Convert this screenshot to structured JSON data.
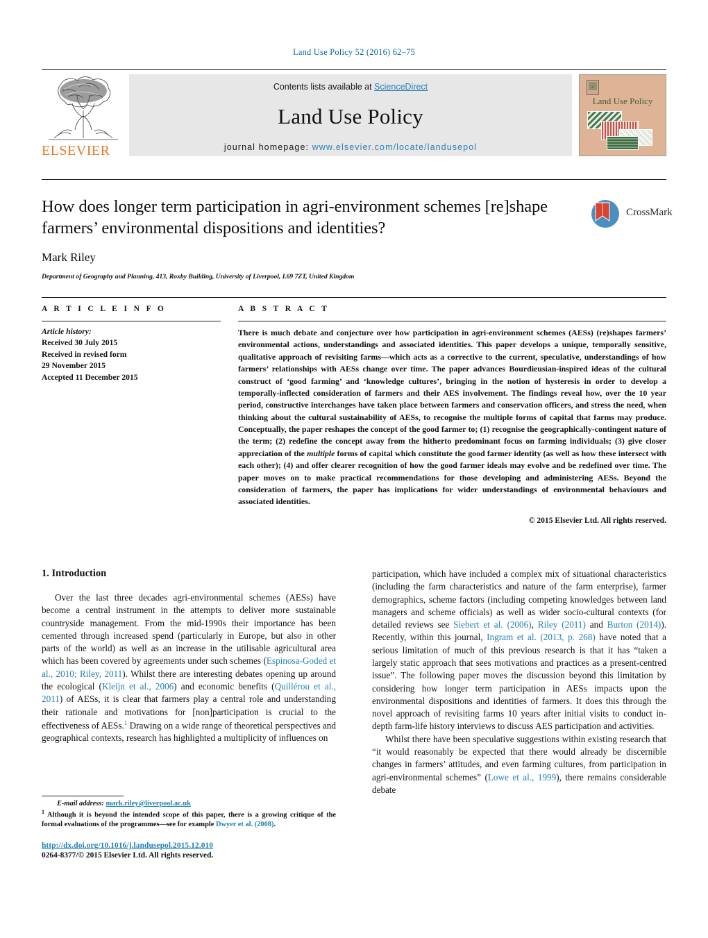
{
  "running_head": "Land Use Policy 52 (2016) 62–75",
  "masthead": {
    "contents_prefix": "Contents lists available at ",
    "sciencedirect": "ScienceDirect",
    "journal_title": "Land Use Policy",
    "homepage_prefix": "journal homepage: ",
    "homepage_url": "www.elsevier.com/locate/landusepol",
    "publisher_wordmark": "ELSEVIER",
    "cover_title": "Land Use Policy",
    "accent_link": "#2a7fb8",
    "cover_bg": "#dfb395"
  },
  "article": {
    "title": "How does longer term participation in agri-environment schemes [re]shape farmers’ environmental dispositions and identities?",
    "author": "Mark Riley",
    "affiliation": "Department of Geography and Planning, 413, Roxby Building, University of Liverpool, L69 7ZT, United Kingdom",
    "crossmark_label": "CrossMark"
  },
  "info": {
    "heading": "A R T I C L E   I N F O",
    "history_label": "Article history:",
    "history": [
      "Received 30 July 2015",
      "Received in revised form",
      "29 November 2015",
      "Accepted 11 December 2015"
    ]
  },
  "abstract": {
    "heading": "A B S T R A C T",
    "part1": "There is much debate and conjecture over how participation in agri-environment schemes (AESs) (re)shapes farmers’ environmental actions, understandings and associated identities. This paper develops a unique, temporally sensitive, qualitative approach of revisiting farms—which acts as a corrective to the current, speculative, understandings of how farmers’ relationships with AESs change over time. The paper advances Bourdieusian-inspired ideas of the cultural construct of ‘good farming’ and ‘knowledge cultures’, bringing in the notion of hysteresis in order to develop a temporally-inflected consideration of farmers and their AES involvement. The findings reveal how, over the 10 year period, constructive interchanges have taken place between farmers and conservation officers, and stress the need, when thinking about the cultural sustainability of AESs, to recognise the multiple forms of capital that farms may produce. Conceptually, the paper reshapes the concept of the good farmer to; (1) recognise the geographically-contingent nature of the term; (2) redefine the concept away from the hitherto predominant focus on farming individuals; (3) give closer appreciation of the ",
    "italic_word": "multiple",
    "part2": " forms of capital which constitute the good farmer identity (as well as how these intersect with each other); (4) and offer clearer recognition of how the good farmer ideals may evolve and be redefined over time. The paper moves on to make practical recommendations for those developing and administering AESs. Beyond the consideration of farmers, the paper has implications for wider understandings of environmental behaviours and associated identities.",
    "copyright": "© 2015 Elsevier Ltd. All rights reserved."
  },
  "body": {
    "section_heading": "1. Introduction",
    "left_p1_a": "Over the last three decades agri-environmental schemes (AESs) have become a central instrument in the attempts to deliver more sustainable countryside management. From the mid-1990s their importance has been cemented through increased spend (particularly in Europe, but also in other parts of the world) as well as an increase in the utilisable agricultural area which has been covered by agreements under such schemes (",
    "ref_espinosa": "Espinosa-Goded et al., 2010; Riley, 2011",
    "left_p1_b": "). Whilst there are interesting debates opening up around the ecological (",
    "ref_kleijn": "Kleijn et al., 2006",
    "left_p1_c": ") and economic benefits (",
    "ref_quillerou": "Quillérou et al., 2011",
    "left_p1_d": ") of AESs, it is clear that farmers play a central role and understanding their rationale and motivations for [non]participation is crucial to the effectiveness of AESs.",
    "footnote_marker": "1",
    "left_p1_e": " Drawing on a wide range of theoretical perspectives and geographical contexts, research has highlighted a multiplicity of influences on",
    "right_p1_a": "participation, which have included a complex mix of situational characteristics (including the farm characteristics and nature of the farm enterprise), farmer demographics, scheme factors (including competing knowledges between land managers and scheme officials) as well as wider socio-cultural contexts (for detailed reviews see ",
    "ref_siebert": "Siebert et al. (2006)",
    "right_p1_b": ", ",
    "ref_riley": "Riley (2011)",
    "right_p1_c": " and ",
    "ref_burton": "Burton (2014)",
    "right_p1_d": "). Recently, within this journal, ",
    "ref_ingram": "Ingram et al. (2013, p. 268)",
    "right_p1_e": " have noted that a serious limitation of much of this previous research is that it has “taken a largely static approach that sees motivations and practices as a present-centred issue”. The following paper moves the discussion beyond this limitation by considering how longer term participation in AESs impacts upon the environmental dispositions and identities of farmers. It does this through the novel approach of revisiting farms 10 years after initial visits to conduct in-depth farm-life history interviews to discuss AES participation and activities.",
    "right_p2_a": "Whilst there have been speculative suggestions within existing research that “it would reasonably be expected that there would already be discernible changes in farmers’ attitudes, and even farming cultures, from participation in agri-environmental schemes” (",
    "ref_lowe": "Lowe et al., 1999",
    "right_p2_b": "), there remains considerable debate"
  },
  "footer": {
    "email_label": "E-mail address:",
    "email": "mark.riley@liverpool.ac.uk",
    "footnote_marker": "1",
    "footnote_a": "Although it is beyond the intended scope of this paper, there is a growing critique of the formal evaluations of the programmes—see for example ",
    "footnote_ref": "Dwyer et al. (2008)",
    "footnote_b": ".",
    "doi": "http://dx.doi.org/10.1016/j.landusepol.2015.12.010",
    "issn": "0264-8377/© 2015 Elsevier Ltd. All rights reserved."
  }
}
